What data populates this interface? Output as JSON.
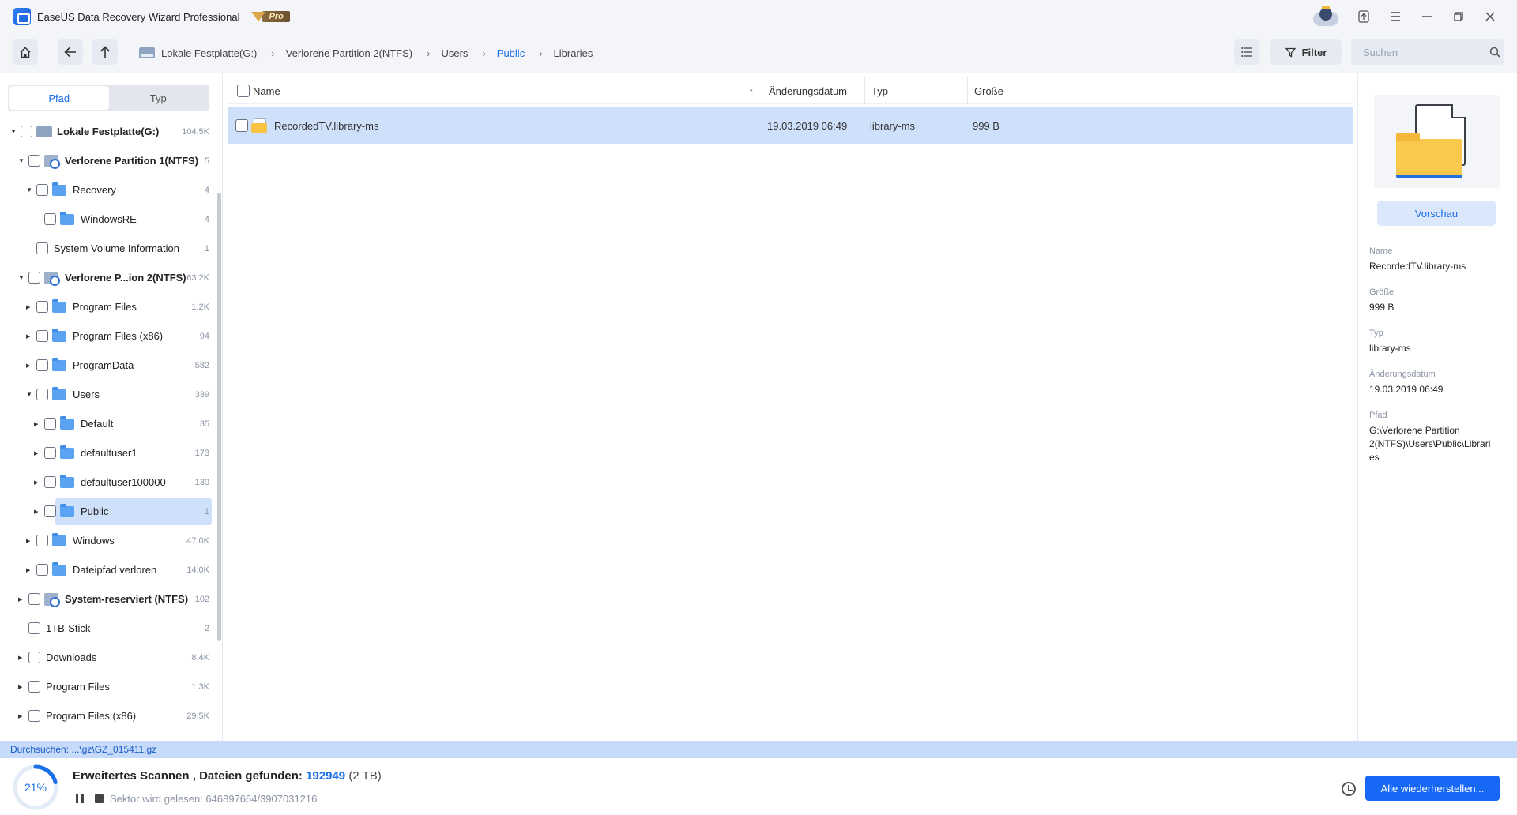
{
  "app": {
    "title": "EaseUS Data Recovery Wizard Professional",
    "badge": "Pro"
  },
  "breadcrumb": [
    {
      "label": "Lokale Festplatte(G:)",
      "active": false
    },
    {
      "label": "Verlorene Partition 2(NTFS)",
      "active": false
    },
    {
      "label": "Users",
      "active": false
    },
    {
      "label": "Public",
      "active": true
    },
    {
      "label": "Libraries",
      "active": false
    }
  ],
  "toolbar": {
    "filter_label": "Filter",
    "search_placeholder": "Suchen"
  },
  "sidebar": {
    "tabs": [
      {
        "label": "Pfad",
        "selected": true
      },
      {
        "label": "Typ",
        "selected": false
      }
    ],
    "tree": [
      {
        "label": "Lokale Festplatte(G:)",
        "count": "104.5K",
        "level": 0,
        "icon": "disk-icon",
        "expander": "open",
        "bold": true
      },
      {
        "label": "Verlorene Partition 1(NTFS)",
        "count": "5",
        "level": 1,
        "icon": "partition-icon",
        "expander": "open",
        "bold": true
      },
      {
        "label": "Recovery",
        "count": "4",
        "level": 2,
        "icon": "folder-icon",
        "expander": "open",
        "bold": false
      },
      {
        "label": "WindowsRE",
        "count": "4",
        "level": 3,
        "icon": "folder-icon",
        "expander": "none",
        "bold": false
      },
      {
        "label": "System Volume Information",
        "count": "1",
        "level": 2,
        "icon": "none",
        "expander": "none",
        "bold": false
      },
      {
        "label": "Verlorene P...ion 2(NTFS)",
        "count": "63.2K",
        "level": 1,
        "icon": "partition-icon",
        "expander": "open",
        "bold": true
      },
      {
        "label": "Program Files",
        "count": "1.2K",
        "level": 2,
        "icon": "folder-icon",
        "expander": "closed",
        "bold": false
      },
      {
        "label": "Program Files (x86)",
        "count": "94",
        "level": 2,
        "icon": "folder-icon",
        "expander": "closed",
        "bold": false
      },
      {
        "label": "ProgramData",
        "count": "582",
        "level": 2,
        "icon": "folder-icon",
        "expander": "closed",
        "bold": false
      },
      {
        "label": "Users",
        "count": "339",
        "level": 2,
        "icon": "folder-icon",
        "expander": "open",
        "bold": false
      },
      {
        "label": "Default",
        "count": "35",
        "level": 3,
        "icon": "folder-icon",
        "expander": "closed",
        "bold": false
      },
      {
        "label": "defaultuser1",
        "count": "173",
        "level": 3,
        "icon": "folder-icon",
        "expander": "closed",
        "bold": false
      },
      {
        "label": "defaultuser100000",
        "count": "130",
        "level": 3,
        "icon": "folder-icon",
        "expander": "closed",
        "bold": false
      },
      {
        "label": "Public",
        "count": "1",
        "level": 3,
        "icon": "folder-icon",
        "expander": "closed",
        "bold": false,
        "selected": true
      },
      {
        "label": "Windows",
        "count": "47.0K",
        "level": 2,
        "icon": "folder-icon",
        "expander": "closed",
        "bold": false
      },
      {
        "label": "Dateipfad verloren",
        "count": "14.0K",
        "level": 2,
        "icon": "folder-icon",
        "expander": "closed",
        "bold": false
      },
      {
        "label": "System-reserviert (NTFS)",
        "count": "102",
        "level": 1,
        "icon": "partition-icon",
        "expander": "closed",
        "bold": true
      },
      {
        "label": "1TB-Stick",
        "count": "2",
        "level": 1,
        "icon": "none",
        "expander": "none",
        "bold": false
      },
      {
        "label": "Downloads",
        "count": "8.4K",
        "level": 1,
        "icon": "none",
        "expander": "closed",
        "bold": false
      },
      {
        "label": "Program Files",
        "count": "1.3K",
        "level": 1,
        "icon": "none",
        "expander": "closed",
        "bold": false
      },
      {
        "label": "Program Files (x86)",
        "count": "29.5K",
        "level": 1,
        "icon": "none",
        "expander": "closed",
        "bold": false
      }
    ]
  },
  "file_list": {
    "columns": {
      "name": "Name",
      "modified": "Änderungsdatum",
      "type": "Typ",
      "size": "Größe",
      "sort_indicator": "↑"
    },
    "rows": [
      {
        "name": "RecordedTV.library-ms",
        "modified": "19.03.2019 06:49",
        "type": "library-ms",
        "size": "999 B"
      }
    ]
  },
  "details": {
    "preview_label": "Vorschau",
    "name_label": "Name",
    "name_value": "RecordedTV.library-ms",
    "size_label": "Größe",
    "size_value": "999 B",
    "type_label": "Typ",
    "type_value": "library-ms",
    "modified_label": "Änderungsdatum",
    "modified_value": "19.03.2019 06:49",
    "path_label": "Pfad",
    "path_value": "G:\\Verlorene Partition 2(NTFS)\\Users\\Public\\Libraries"
  },
  "status": {
    "scanning_text": "Durchsuchen: ...\\gz\\GZ_015411.gz",
    "progress_percent": 21,
    "progress_label": "21%",
    "scan_title": "Erweitertes Scannen , Dateien gefunden:",
    "files_found": "192949",
    "found_size": "(2 TB)",
    "sector_text": "Sektor wird gelesen: 646897664/3907031216",
    "recover_all_label": "Alle wiederherstellen..."
  },
  "colors": {
    "accent": "#1a6ee6",
    "selection": "#cfe0fb",
    "primary_button": "#1769f5"
  }
}
